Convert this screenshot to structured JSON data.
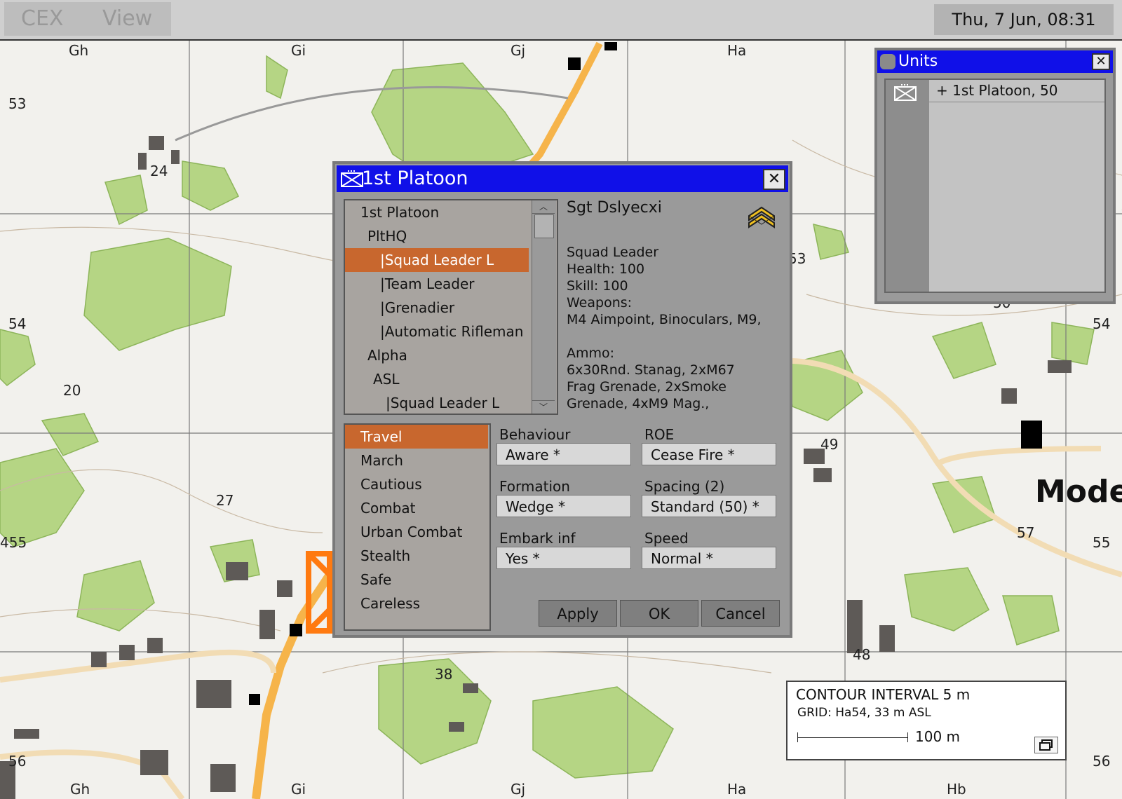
{
  "menubar": {
    "cex": "CEX",
    "view": "View"
  },
  "clock": "Thu, 7 Jun, 08:31",
  "map": {
    "grid_labels_top": [
      "Gh",
      "Gi",
      "Gj",
      "Ha"
    ],
    "grid_labels_bottom": [
      "Gh",
      "Gi",
      "Gj",
      "Ha",
      "Hb"
    ],
    "grid_labels_left": [
      "53",
      "54",
      "455",
      "56"
    ],
    "grid_labels_right": [
      "54",
      "55",
      "56"
    ],
    "heights": [
      "24",
      "20",
      "27",
      "38",
      "53",
      "49",
      "57",
      "48",
      "50"
    ],
    "town_label": "Mode"
  },
  "units_window": {
    "title": "Units",
    "item": "+ 1st Platoon, 50"
  },
  "platoon_dialog": {
    "title": "1st Platoon",
    "tree": [
      "1st Platoon",
      "PltHQ",
      "|Squad Leader L",
      "|Team Leader",
      "|Grenadier",
      "|Automatic Rifleman",
      "Alpha",
      "ASL",
      "|Squad Leader L"
    ],
    "info": {
      "name": "Sgt Dslyecxi",
      "role": "Squad Leader",
      "health": "Health: 100",
      "skill": "Skill: 100",
      "weapons_label": "Weapons:",
      "weapons": "M4 Aimpoint, Binoculars, M9,",
      "ammo_label": "Ammo:",
      "ammo_1": "6x30Rnd. Stanag, 2xM67",
      "ammo_2": "Frag Grenade, 2xSmoke",
      "ammo_3": "Grenade, 4xM9 Mag.,"
    },
    "modes": [
      "Travel",
      "March",
      "Cautious",
      "Combat",
      "Urban Combat",
      "Stealth",
      "Safe",
      "Careless"
    ],
    "fields": {
      "behaviour_label": "Behaviour",
      "behaviour": "Aware *",
      "roe_label": "ROE",
      "roe": "Cease Fire *",
      "formation_label": "Formation",
      "formation": "Wedge *",
      "spacing_label": "Spacing (2)",
      "spacing": "Standard (50) *",
      "embark_label": "Embark inf",
      "embark": "Yes *",
      "speed_label": "Speed",
      "speed": "Normal *"
    },
    "buttons": {
      "apply": "Apply",
      "ok": "OK",
      "cancel": "Cancel"
    }
  },
  "legend": {
    "contour": "CONTOUR INTERVAL 5 m",
    "grid": "GRID: Ha54, 33 m ASL",
    "scale": "100 m"
  },
  "colors": {
    "titlebar": "#1010e8",
    "selection": "#c8672e",
    "forest": "#b5d584",
    "road": "#f6b44a"
  }
}
